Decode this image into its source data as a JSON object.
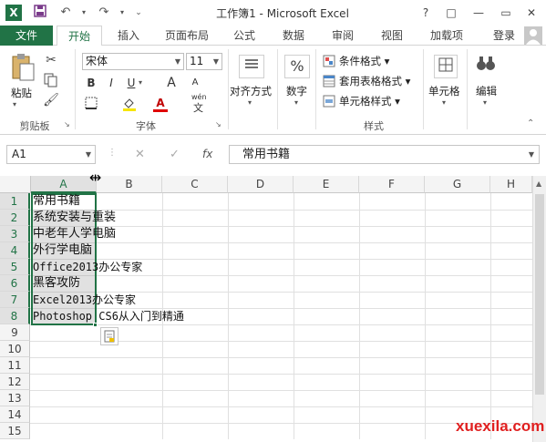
{
  "titlebar": {
    "app_title": "工作簿1 - Microsoft Excel",
    "app_icon": "excel-logo-icon",
    "help": "?",
    "restore": "□",
    "minimize": "—",
    "close": "✕"
  },
  "tabs": [
    "文件",
    "开始",
    "插入",
    "页面布局",
    "公式",
    "数据",
    "审阅",
    "视图",
    "加载项"
  ],
  "active_tab": "开始",
  "login": "登录",
  "ribbon": {
    "clipboard": {
      "paste": "粘贴",
      "group": "剪贴板"
    },
    "font": {
      "name": "宋体",
      "size": "11",
      "group": "字体",
      "bold": "B",
      "italic": "I",
      "underline": "U",
      "grow": "A",
      "shrink": "A",
      "font_color": "A",
      "wen": "wén",
      "wen2": "文"
    },
    "alignment": {
      "label": "对齐方式"
    },
    "number": {
      "label": "数字",
      "symbol": "%"
    },
    "styles": {
      "conditional": "条件格式",
      "table": "套用表格格式",
      "cell": "单元格样式",
      "group": "样式"
    },
    "cells": {
      "label": "单元格"
    },
    "editing": {
      "label": "编辑"
    }
  },
  "formula_bar": {
    "name_box": "A1",
    "fx": "fx",
    "content": "常用书籍"
  },
  "columns": [
    "A",
    "B",
    "C",
    "D",
    "E",
    "F",
    "G",
    "H"
  ],
  "rows": [
    "1",
    "2",
    "3",
    "4",
    "5",
    "6",
    "7",
    "8",
    "9",
    "10",
    "11",
    "12",
    "13",
    "14",
    "15"
  ],
  "cells": [
    "常用书籍",
    "系统安装与重装",
    "中老年人学电脑",
    "外行学电脑",
    "Office2013办公专家",
    "黑客攻防",
    "Excel2013办公专家",
    "Photoshop CS6从入门到精通"
  ],
  "watermark": "xuexila.com",
  "colors": {
    "accent": "#217346",
    "watermark": "#e02020"
  }
}
